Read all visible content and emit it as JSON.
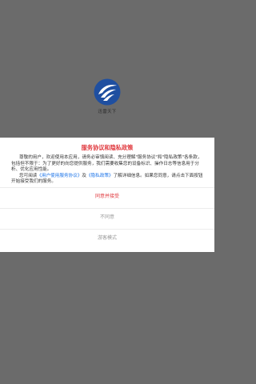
{
  "app": {
    "name": "迅雷天下",
    "logo_icon": "app-logo-icon"
  },
  "dialog": {
    "title": "服务协议和隐私政策",
    "para1": "尊敬的用户，欢迎使用本应用，请务必审慎阅读、充分理解\"服务协议\"和\"隐私政策\"各条款，包括但不限于：为了更好的向您提供服务，我们需要收集您的设备标识、操作日志等信息用于分析、优化应用性能。",
    "para2_prefix": "您可阅读",
    "terms_link": "《用户使用服务协议》",
    "para2_and": "及",
    "privacy_link": "《隐私政策》",
    "para2_suffix": "了解详细信息。如果您同意，请点击下面按钮开始接受我们的服务。",
    "agree_label": "同意并接受",
    "disagree_label": "不同意",
    "guest_label": "游客模式"
  },
  "colors": {
    "overlay": "#6b6b6b",
    "title": "#e0393e",
    "link": "#1a73e8",
    "secondary_button": "#9a9a9a"
  }
}
